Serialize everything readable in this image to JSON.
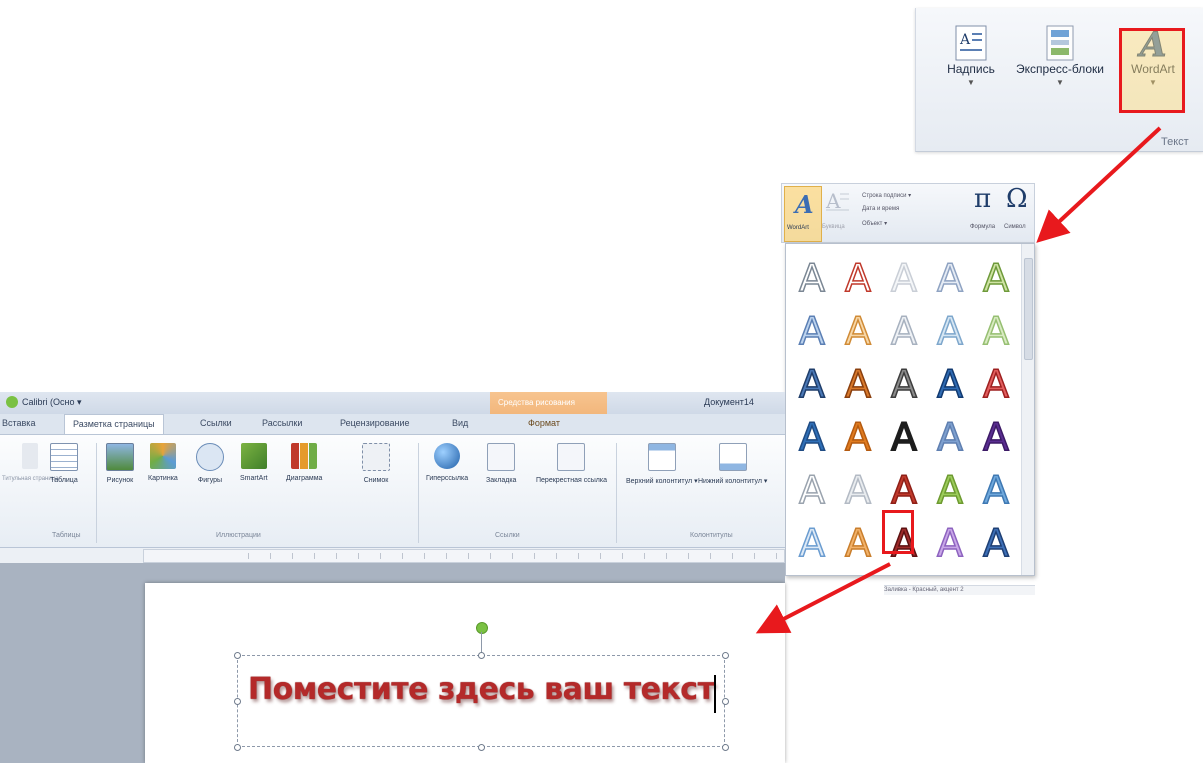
{
  "ribbon_crop": {
    "buttons": [
      {
        "label": "Надпись",
        "icon": "text-box-icon"
      },
      {
        "label": "Экспресс-блоки",
        "icon": "quick-parts-icon"
      },
      {
        "label": "WordArt",
        "icon": "wordart-icon"
      }
    ],
    "group_label": "Текст"
  },
  "gallery": {
    "head": {
      "wordart_label": "WordArt",
      "buvitsa_label": "Буквица",
      "signature_line": "Строка подписи ▾",
      "date_time": "Дата и время",
      "object": "Объект ▾",
      "formula_label": "Формула",
      "symbol_label": "Символ"
    },
    "status": "Заливка - Красный, акцент 2",
    "styles": [
      [
        "#ffffff|#7b8794",
        "#ffffff|#c0392b",
        "#f4f6f8|#c9ced6",
        "#e6ecf5|#8fa3c2",
        "#cfe3a4|#6e9a3a"
      ],
      [
        "#bcd3ee|#5b7fb4",
        "#f7d7a8|#d08b36",
        "#eef1f5|#a7b1bf",
        "#d6e6f3|#7ea7cc",
        "#d9ebc2|#96bf72"
      ],
      [
        "#4b79b7|#1f3d6a",
        "#d97a2c|#8a3f0e",
        "#8c8c8c|#3d3d3d",
        "#2f6bb3|#123a70",
        "#e25e5e|#9d1f1f"
      ],
      [
        "#2f6fb7|#1f4b83",
        "#e07b1f|#b45a10",
        "#1d1d1d|#1d1d1d",
        "#7ea0cf|#5f7fb0",
        "#5a2d91|#3c1a66"
      ],
      [
        "#ffffff|#9aa3ae",
        "#e9ecef|#b3bac4",
        "#c0392b|#8e1f17",
        "#9ccc5b|#6d9a30",
        "#6fa8dc|#3e78b2"
      ],
      [
        "#dde9f6|#6a9cd0",
        "#f2b26a|#c97e2c",
        "#9e2a2a|#5c1111",
        "#c9a7e8|#8d63bf",
        "#3d6fb6|#1e3f74"
      ]
    ]
  },
  "word": {
    "qat_font": "Calibri (Осно ▾",
    "title": "Документ14",
    "tools_label": "Средства рисования",
    "tabs": [
      "Вставка",
      "Разметка страницы",
      "Ссылки",
      "Рассылки",
      "Рецензирование",
      "Вид",
      "Формат"
    ],
    "ribbon_buttons": [
      "Таблица",
      "Рисунок",
      "Картинка",
      "Фигуры",
      "SmartArt",
      "Диаграмма",
      "Снимок",
      "Гиперссылка",
      "Закладка",
      "Перекрестная ссылка",
      "Верхний колонтитул ▾",
      "Нижний колонтитул ▾"
    ],
    "groups": [
      "Таблицы",
      "Иллюстрации",
      "Ссылки",
      "Колонтитулы"
    ],
    "left_cut": "Титульная страница"
  },
  "textbox": {
    "text": "Поместите здесь ваш текст"
  }
}
